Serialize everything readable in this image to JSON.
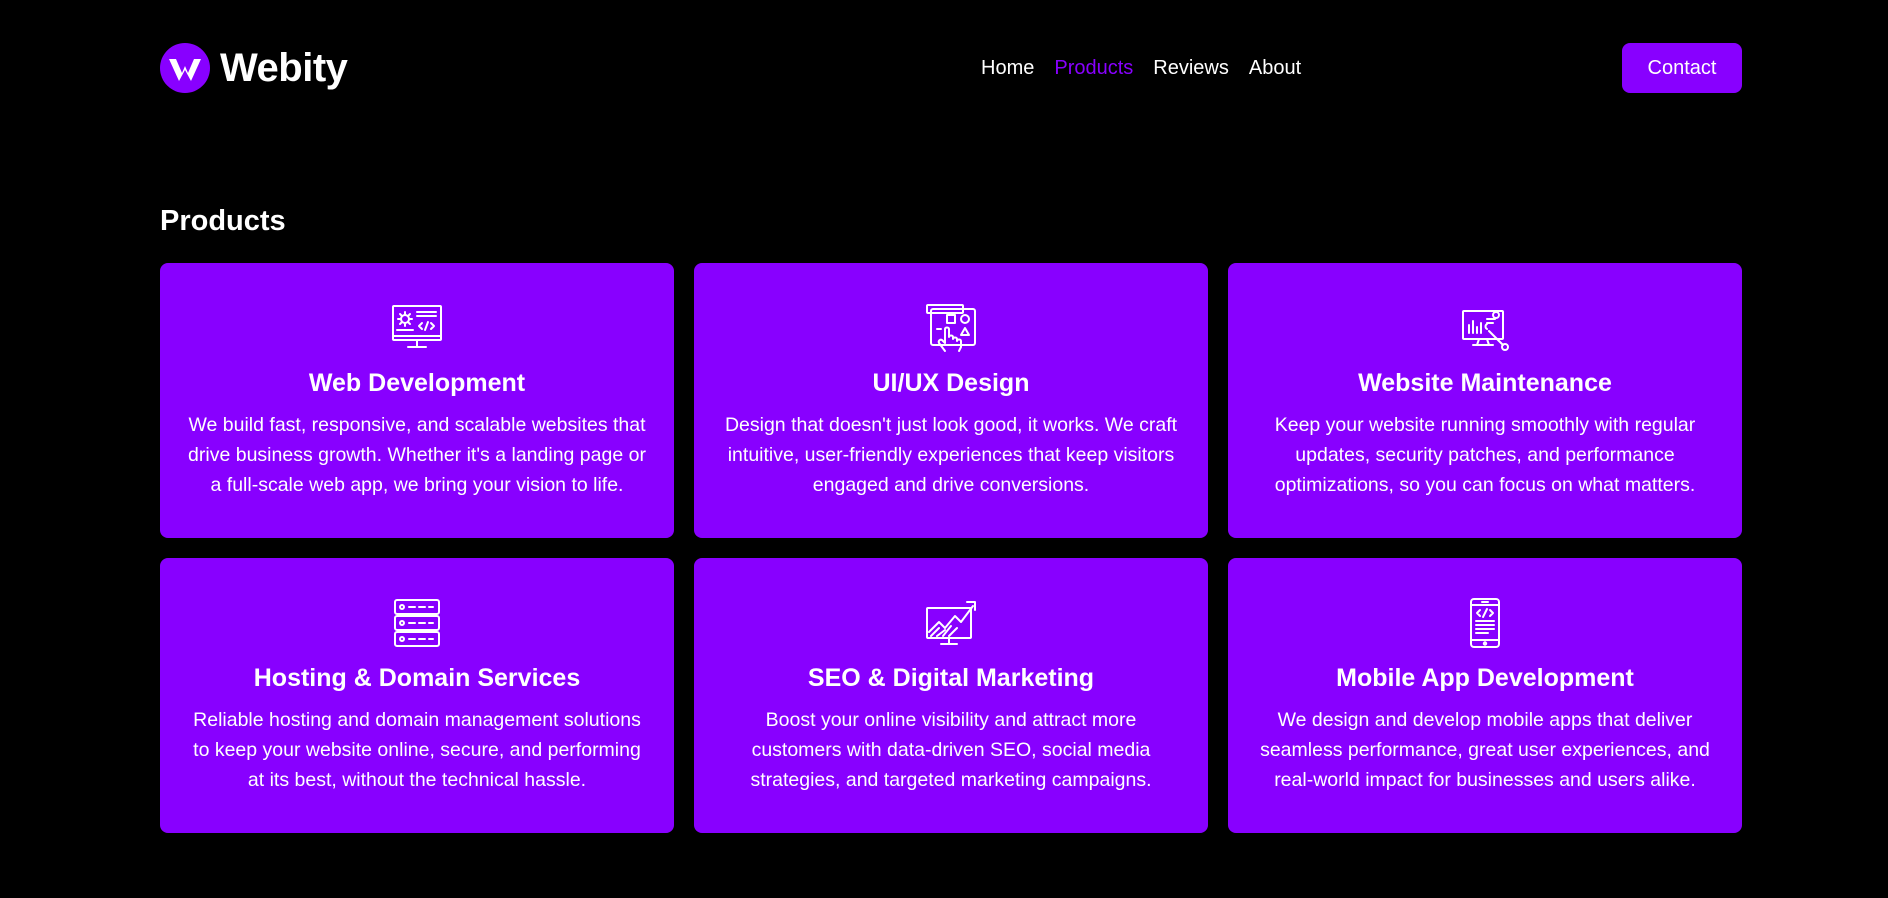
{
  "header": {
    "brand_name": "Webity",
    "nav": [
      {
        "label": "Home",
        "active": false
      },
      {
        "label": "Products",
        "active": true
      },
      {
        "label": "Reviews",
        "active": false
      },
      {
        "label": "About",
        "active": false
      }
    ],
    "contact_label": "Contact"
  },
  "products": {
    "title": "Products",
    "cards": [
      {
        "icon": "monitor-code-icon",
        "title": "Web Development",
        "description": "We build fast, responsive, and scalable websites that drive business growth. Whether it's a landing page or a full-scale web app, we bring your vision to life."
      },
      {
        "icon": "touch-design-icon",
        "title": "UI/UX Design",
        "description": "Design that doesn't just look good, it works. We craft intuitive, user-friendly experiences that keep visitors engaged and drive conversions."
      },
      {
        "icon": "monitor-wrench-icon",
        "title": "Website Maintenance",
        "description": "Keep your website running smoothly with regular updates, security patches, and performance optimizations, so you can focus on what matters."
      },
      {
        "icon": "server-stack-icon",
        "title": "Hosting & Domain Services",
        "description": "Reliable hosting and domain management solutions to keep your website online, secure, and performing at its best, without the technical hassle."
      },
      {
        "icon": "growth-chart-icon",
        "title": "SEO & Digital Marketing",
        "description": "Boost your online visibility and attract more customers with data-driven SEO, social media strategies, and targeted marketing campaigns."
      },
      {
        "icon": "mobile-code-icon",
        "title": "Mobile App Development",
        "description": "We design and develop mobile apps that deliver seamless performance, great user experiences, and real-world impact for businesses and users alike."
      }
    ]
  },
  "colors": {
    "accent": "#8800ff",
    "background": "#000000",
    "text": "#ffffff"
  }
}
